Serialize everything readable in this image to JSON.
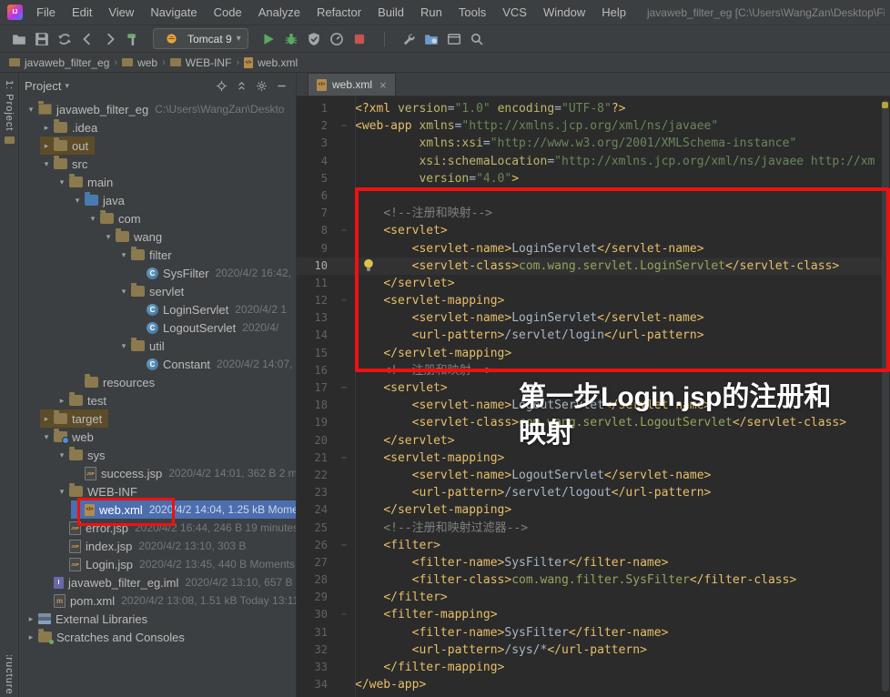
{
  "window_title": "javaweb_filter_eg [C:\\Users\\WangZan\\Desktop\\Final\\javawe",
  "menu": {
    "items": [
      "File",
      "Edit",
      "View",
      "Navigate",
      "Code",
      "Analyze",
      "Refactor",
      "Build",
      "Run",
      "Tools",
      "VCS",
      "Window",
      "Help"
    ]
  },
  "toolbar": {
    "left_icons": [
      "open-icon",
      "save-icon",
      "sync-icon",
      "back-icon",
      "forward-icon",
      "build-hammer-icon"
    ],
    "run_config": "Tomcat 9",
    "run_icons": [
      "run-icon",
      "debug-icon",
      "coverage-icon",
      "profiler-icon",
      "stop-icon"
    ],
    "right_icons": [
      "wrench-icon",
      "project-structure-icon",
      "window-icon",
      "search-icon"
    ]
  },
  "breadcrumbs": [
    {
      "label": "javaweb_filter_eg",
      "icon": "folder"
    },
    {
      "label": "web",
      "icon": "folder"
    },
    {
      "label": "WEB-INF",
      "icon": "folder"
    },
    {
      "label": "web.xml",
      "icon": "xml"
    }
  ],
  "left_strip": {
    "top_label": "1: Project",
    "bottom_label": "Structure"
  },
  "project_panel": {
    "title": "Project",
    "header_icons": [
      "locate-icon",
      "collapse-all-icon",
      "gear-icon",
      "hide-icon"
    ],
    "tree": [
      {
        "label": "javaweb_filter_eg",
        "meta": "C:\\Users\\WangZan\\Deskto",
        "level": 0,
        "icon": "project",
        "state": "expanded"
      },
      {
        "label": ".idea",
        "level": 1,
        "icon": "folder",
        "state": "collapsed"
      },
      {
        "label": "out",
        "level": 1,
        "icon": "folder",
        "state": "collapsed",
        "excluded": true
      },
      {
        "label": "src",
        "level": 1,
        "icon": "folder",
        "state": "expanded"
      },
      {
        "label": "main",
        "level": 2,
        "icon": "folder",
        "state": "expanded"
      },
      {
        "label": "java",
        "level": 3,
        "icon": "src-folder",
        "state": "expanded"
      },
      {
        "label": "com",
        "level": 4,
        "icon": "package",
        "state": "expanded"
      },
      {
        "label": "wang",
        "level": 5,
        "icon": "package",
        "state": "expanded"
      },
      {
        "label": "filter",
        "level": 6,
        "icon": "package",
        "state": "expanded"
      },
      {
        "label": "SysFilter",
        "meta": "2020/4/2 16:42,",
        "level": 7,
        "icon": "class",
        "state": "leaf"
      },
      {
        "label": "servlet",
        "level": 6,
        "icon": "package",
        "state": "expanded"
      },
      {
        "label": "LoginServlet",
        "meta": "2020/4/2 1",
        "level": 7,
        "icon": "class",
        "state": "leaf"
      },
      {
        "label": "LogoutServlet",
        "meta": "2020/4/",
        "level": 7,
        "icon": "class",
        "state": "leaf"
      },
      {
        "label": "util",
        "level": 6,
        "icon": "package",
        "state": "expanded"
      },
      {
        "label": "Constant",
        "meta": "2020/4/2 14:07,",
        "level": 7,
        "icon": "class",
        "state": "leaf"
      },
      {
        "label": "resources",
        "level": 3,
        "icon": "folder",
        "state": "leaf"
      },
      {
        "label": "test",
        "level": 2,
        "icon": "folder",
        "state": "collapsed"
      },
      {
        "label": "target",
        "level": 1,
        "icon": "folder",
        "state": "collapsed",
        "excluded": true
      },
      {
        "label": "web",
        "level": 1,
        "icon": "web-folder",
        "state": "expanded"
      },
      {
        "label": "sys",
        "level": 2,
        "icon": "folder",
        "state": "expanded"
      },
      {
        "label": "success.jsp",
        "meta": "2020/4/2 14:01, 362 B 2 mi",
        "level": 3,
        "icon": "jsp",
        "state": "leaf"
      },
      {
        "label": "WEB-INF",
        "level": 2,
        "icon": "folder",
        "state": "expanded"
      },
      {
        "label": "web.xml",
        "meta": "2020/4/2 14:04, 1.25 kB Mome",
        "level": 3,
        "icon": "xml",
        "state": "leaf",
        "selected": true
      },
      {
        "label": "error.jsp",
        "meta": "2020/4/2 16:44, 246 B 19 minutes",
        "level": 2,
        "icon": "jsp",
        "state": "leaf"
      },
      {
        "label": "index.jsp",
        "meta": "2020/4/2 13:10, 303 B",
        "level": 2,
        "icon": "jsp",
        "state": "leaf"
      },
      {
        "label": "Login.jsp",
        "meta": "2020/4/2 13:45, 440 B Moments",
        "level": 2,
        "icon": "jsp",
        "state": "leaf"
      },
      {
        "label": "javaweb_filter_eg.iml",
        "meta": "2020/4/2 13:10, 657 B",
        "level": 1,
        "icon": "iml",
        "state": "leaf"
      },
      {
        "label": "pom.xml",
        "meta": "2020/4/2 13:08, 1.51 kB Today 13:11",
        "level": 1,
        "icon": "maven",
        "state": "leaf"
      },
      {
        "label": "External Libraries",
        "level": 0,
        "icon": "libs",
        "state": "collapsed"
      },
      {
        "label": "Scratches and Consoles",
        "level": 0,
        "icon": "scratch",
        "state": "collapsed"
      }
    ]
  },
  "editor": {
    "tab": {
      "label": "web.xml",
      "icon": "xml"
    },
    "caret_line": 10,
    "bulb_line": 10,
    "fold_lines": [
      2,
      8,
      12,
      17,
      21,
      26,
      30
    ],
    "lines": [
      [
        [
          "tag",
          "<?xml "
        ],
        [
          "attr",
          "version"
        ],
        [
          "eq",
          "="
        ],
        [
          "str",
          "\"1.0\""
        ],
        [
          "ws",
          " "
        ],
        [
          "attr",
          "encoding"
        ],
        [
          "eq",
          "="
        ],
        [
          "str",
          "\"UTF-8\""
        ],
        [
          "tag",
          "?>"
        ]
      ],
      [
        [
          "tag",
          "<web-app "
        ],
        [
          "attr",
          "xmlns"
        ],
        [
          "eq",
          "="
        ],
        [
          "str",
          "\"http://xmlns.jcp.org/xml/ns/javaee\""
        ]
      ],
      [
        [
          "ws",
          "         "
        ],
        [
          "attr",
          "xmlns:xsi"
        ],
        [
          "eq",
          "="
        ],
        [
          "str",
          "\"http://www.w3.org/2001/XMLSchema-instance\""
        ]
      ],
      [
        [
          "ws",
          "         "
        ],
        [
          "attr",
          "xsi:schemaLocation"
        ],
        [
          "eq",
          "="
        ],
        [
          "str",
          "\"http://xmlns.jcp.org/xml/ns/javaee http://xm"
        ]
      ],
      [
        [
          "ws",
          "         "
        ],
        [
          "attr",
          "version"
        ],
        [
          "eq",
          "="
        ],
        [
          "str",
          "\"4.0\""
        ],
        [
          "tag",
          ">"
        ]
      ],
      [],
      [
        [
          "ws",
          "    "
        ],
        [
          "com",
          "<!--注册和映射-->"
        ]
      ],
      [
        [
          "ws",
          "    "
        ],
        [
          "tag",
          "<servlet>"
        ]
      ],
      [
        [
          "ws",
          "        "
        ],
        [
          "tag",
          "<servlet-name>"
        ],
        [
          "txt",
          "LoginServlet"
        ],
        [
          "tag",
          "</servlet-name>"
        ]
      ],
      [
        [
          "ws",
          "        "
        ],
        [
          "tag",
          "<servlet-class>"
        ],
        [
          "cls",
          "com.wang.servlet.LoginServlet"
        ],
        [
          "tag",
          "</servlet-class>"
        ]
      ],
      [
        [
          "ws",
          "    "
        ],
        [
          "tag",
          "</servlet>"
        ]
      ],
      [
        [
          "ws",
          "    "
        ],
        [
          "tag",
          "<servlet-mapping>"
        ]
      ],
      [
        [
          "ws",
          "        "
        ],
        [
          "tag",
          "<servlet-name>"
        ],
        [
          "txt",
          "LoginServlet"
        ],
        [
          "tag",
          "</servlet-name>"
        ]
      ],
      [
        [
          "ws",
          "        "
        ],
        [
          "tag",
          "<url-pattern>"
        ],
        [
          "txt",
          "/servlet/login"
        ],
        [
          "tag",
          "</url-pattern>"
        ]
      ],
      [
        [
          "ws",
          "    "
        ],
        [
          "tag",
          "</servlet-mapping>"
        ]
      ],
      [
        [
          "ws",
          "    "
        ],
        [
          "com",
          "<!--注册和映射-->"
        ]
      ],
      [
        [
          "ws",
          "    "
        ],
        [
          "tag",
          "<servlet>"
        ]
      ],
      [
        [
          "ws",
          "        "
        ],
        [
          "tag",
          "<servlet-name>"
        ],
        [
          "txt",
          "LogoutServlet"
        ],
        [
          "tag",
          "</servlet-name>"
        ]
      ],
      [
        [
          "ws",
          "        "
        ],
        [
          "tag",
          "<servlet-class>"
        ],
        [
          "cls",
          "com.wang.servlet.LogoutServlet"
        ],
        [
          "tag",
          "</servlet-class>"
        ]
      ],
      [
        [
          "ws",
          "    "
        ],
        [
          "tag",
          "</servlet>"
        ]
      ],
      [
        [
          "ws",
          "    "
        ],
        [
          "tag",
          "<servlet-mapping>"
        ]
      ],
      [
        [
          "ws",
          "        "
        ],
        [
          "tag",
          "<servlet-name>"
        ],
        [
          "txt",
          "LogoutServlet"
        ],
        [
          "tag",
          "</servlet-name>"
        ]
      ],
      [
        [
          "ws",
          "        "
        ],
        [
          "tag",
          "<url-pattern>"
        ],
        [
          "txt",
          "/servlet/logout"
        ],
        [
          "tag",
          "</url-pattern>"
        ]
      ],
      [
        [
          "ws",
          "    "
        ],
        [
          "tag",
          "</servlet-mapping>"
        ]
      ],
      [
        [
          "ws",
          "    "
        ],
        [
          "com",
          "<!--注册和映射过滤器-->"
        ]
      ],
      [
        [
          "ws",
          "    "
        ],
        [
          "tag",
          "<filter>"
        ]
      ],
      [
        [
          "ws",
          "        "
        ],
        [
          "tag",
          "<filter-name>"
        ],
        [
          "txt",
          "SysFilter"
        ],
        [
          "tag",
          "</filter-name>"
        ]
      ],
      [
        [
          "ws",
          "        "
        ],
        [
          "tag",
          "<filter-class>"
        ],
        [
          "cls",
          "com.wang.filter.SysFilter"
        ],
        [
          "tag",
          "</filter-class>"
        ]
      ],
      [
        [
          "ws",
          "    "
        ],
        [
          "tag",
          "</filter>"
        ]
      ],
      [
        [
          "ws",
          "    "
        ],
        [
          "tag",
          "<filter-mapping>"
        ]
      ],
      [
        [
          "ws",
          "        "
        ],
        [
          "tag",
          "<filter-name>"
        ],
        [
          "txt",
          "SysFilter"
        ],
        [
          "tag",
          "</filter-name>"
        ]
      ],
      [
        [
          "ws",
          "        "
        ],
        [
          "tag",
          "<url-pattern>"
        ],
        [
          "txt",
          "/sys/*"
        ],
        [
          "tag",
          "</url-pattern>"
        ]
      ],
      [
        [
          "ws",
          "    "
        ],
        [
          "tag",
          "</filter-mapping>"
        ]
      ],
      [
        [
          "tag",
          "</web-app>"
        ]
      ]
    ]
  },
  "annotations": {
    "callout_lines": [
      "第一步Login.jsp的注册和",
      "映射"
    ],
    "box_color": "#ee1111"
  },
  "colors": {
    "panel_bg": "#3c3f41",
    "editor_bg": "#2b2b2b",
    "selection_blue": "#4b6eaf",
    "excluded_bg": "#5c4c28",
    "accent_red": "#ee1111",
    "tag_yellow": "#e8bf6a",
    "string_green": "#6a8759"
  }
}
